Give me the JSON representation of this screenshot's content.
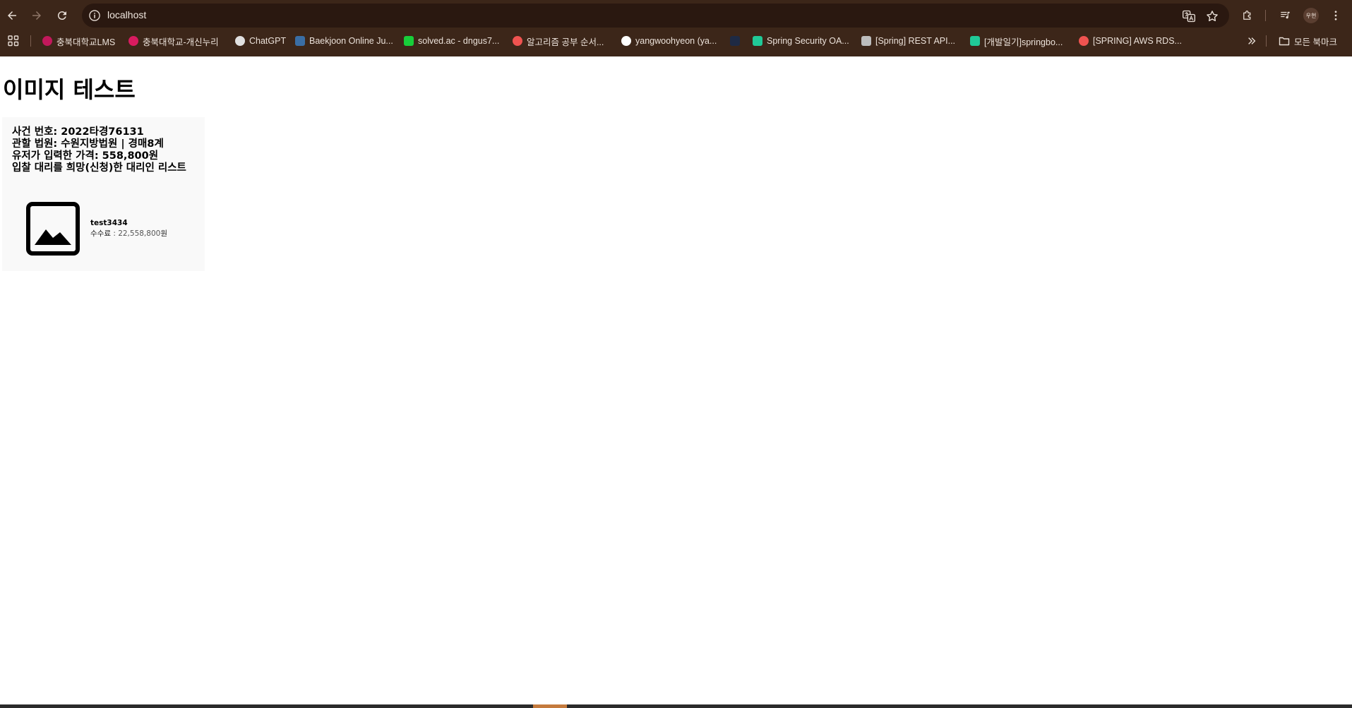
{
  "browser": {
    "url": "localhost",
    "avatar_label": "우현",
    "bookmarks": [
      {
        "label": "충북대학교LMS",
        "color": "#c2185b"
      },
      {
        "label": "충북대학교-개신누리",
        "color": "#d81b60"
      },
      {
        "label": "ChatGPT",
        "color": "#e0e0e0"
      },
      {
        "label": "Baekjoon Online Ju...",
        "color": "#3a6ea5"
      },
      {
        "label": "solved.ac - dngus7...",
        "color": "#17ce3a"
      },
      {
        "label": "알고리즘 공부 순서...",
        "color": "#ef5350"
      },
      {
        "label": "yangwoohyeon (ya...",
        "color": "#ffffff"
      },
      {
        "label": "",
        "color": "#1e2a44"
      },
      {
        "label": "Spring Security OA...",
        "color": "#20c997"
      },
      {
        "label": "[Spring] REST API...",
        "color": "#bdbdbd"
      },
      {
        "label": "[개발일기]springbo...",
        "color": "#20c997"
      },
      {
        "label": "[SPRING] AWS RDS...",
        "color": "#ef5350"
      }
    ],
    "all_bookmarks_label": "모든 북마크"
  },
  "page": {
    "title": "이미지 테스트",
    "case_number": "사건 번호: 2022타경76131",
    "court": "관할 법원: 수원지방법원 | 경매8계",
    "user_price": "유저가 입력한 가격: 558,800원",
    "agent_list_heading": "입찰 대리를 희망(신청)한 대리인 리스트",
    "agents": [
      {
        "name": "test3434",
        "fee_label": "수수료",
        "fee_value": " : 22,558,800",
        "fee_unit": "원"
      }
    ]
  }
}
